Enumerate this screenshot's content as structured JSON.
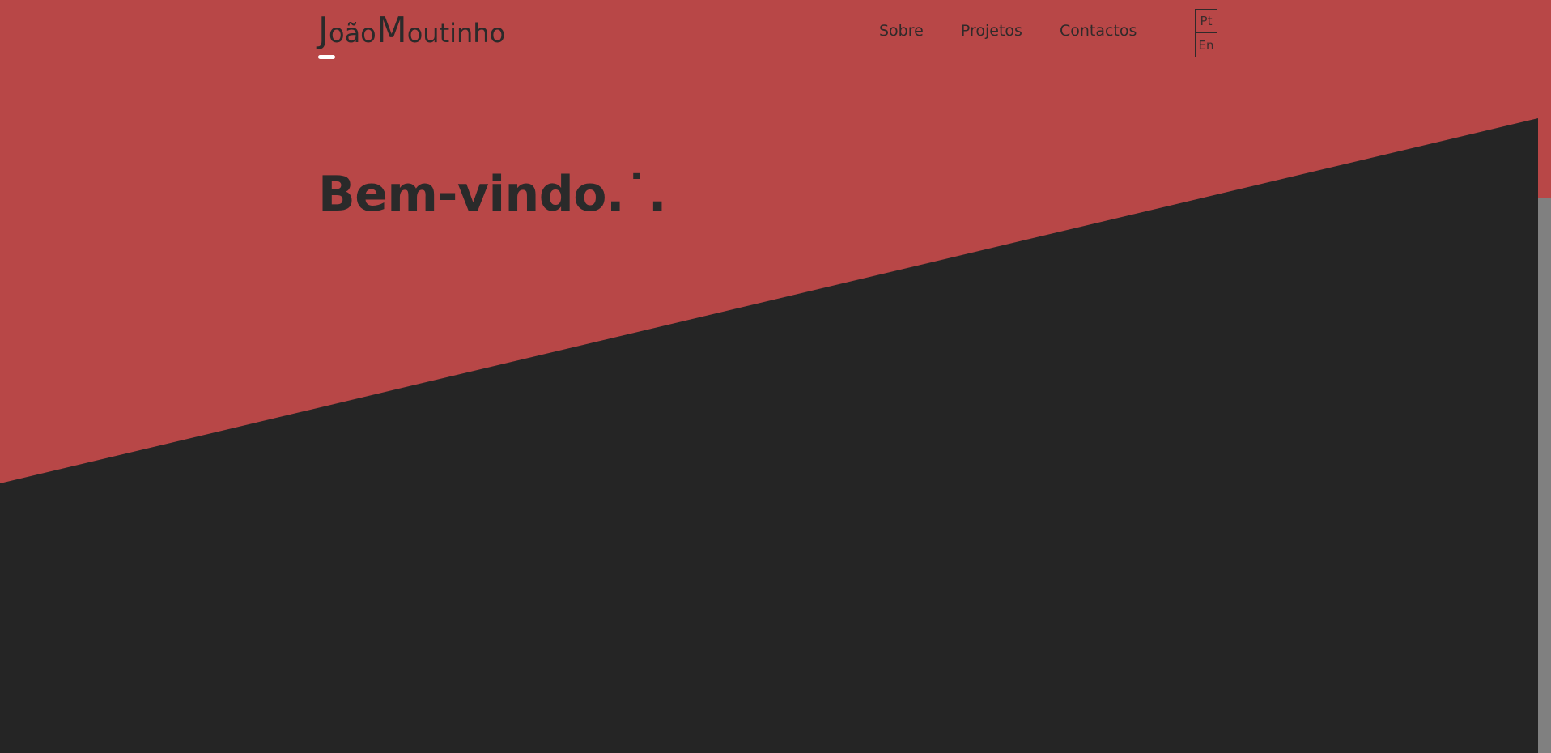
{
  "colors": {
    "accent": "#b84747",
    "dark": "#252525",
    "text": "#2a2a2a",
    "underline": "#ffffff",
    "scroll_thumb": "#808080"
  },
  "header": {
    "logo_initial_first": "J",
    "logo_rest_first": "oão",
    "logo_initial_last": "M",
    "logo_rest_last": "outinho"
  },
  "nav": {
    "items": [
      {
        "label": "Sobre"
      },
      {
        "label": "Projetos"
      },
      {
        "label": "Contactos"
      }
    ]
  },
  "language": {
    "options": [
      {
        "label": "Pt"
      },
      {
        "label": "En"
      }
    ]
  },
  "hero": {
    "title": "Bem-vindo.˙."
  }
}
